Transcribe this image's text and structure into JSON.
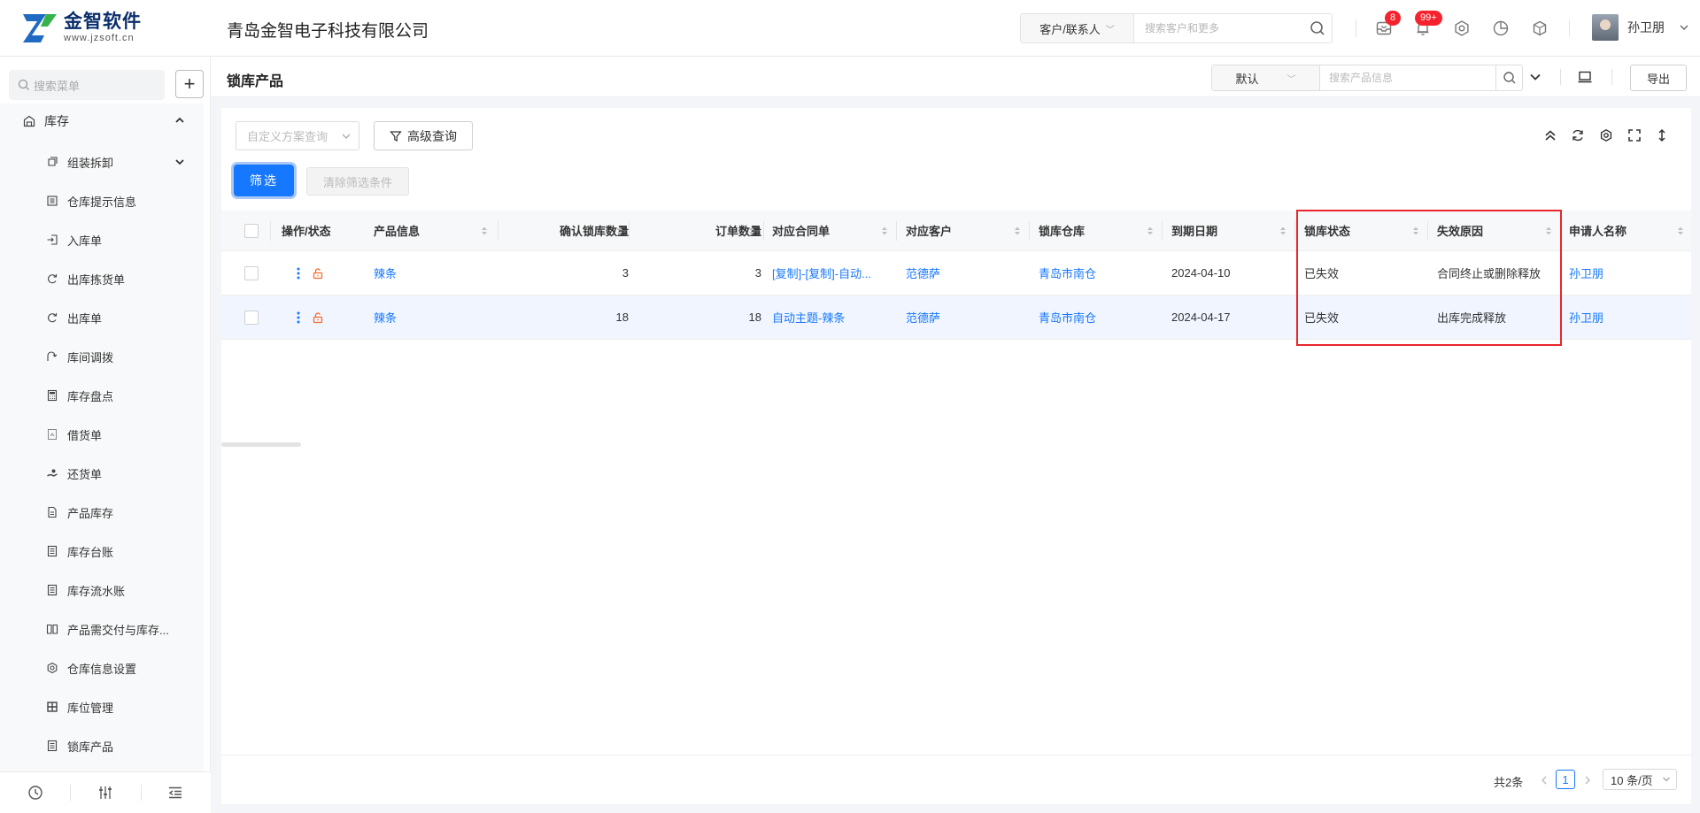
{
  "brand": {
    "name": "金智软件",
    "url": "www.jzsoft.cn",
    "company": "青岛金智电子科技有限公司",
    "color": "#1f6bc1"
  },
  "header": {
    "search_scope": "客户/联系人",
    "search_placeholder": "搜索客户和更多",
    "message_badge": "8",
    "notification_badge": "99+",
    "user_name": "孙卫朋"
  },
  "sidebar": {
    "search_placeholder": "搜索菜单",
    "group_label": "库存",
    "items": [
      {
        "label": "组装拆卸",
        "icon": "assembly-icon",
        "has_children": true
      },
      {
        "label": "仓库提示信息",
        "icon": "list-icon"
      },
      {
        "label": "入库单",
        "icon": "inbound-icon"
      },
      {
        "label": "出库拣货单",
        "icon": "pick-icon"
      },
      {
        "label": "出库单",
        "icon": "outbound-icon"
      },
      {
        "label": "库间调拨",
        "icon": "transfer-icon"
      },
      {
        "label": "库存盘点",
        "icon": "calculator-icon"
      },
      {
        "label": "借货单",
        "icon": "borrow-icon"
      },
      {
        "label": "还货单",
        "icon": "return-icon"
      },
      {
        "label": "产品库存",
        "icon": "document-icon"
      },
      {
        "label": "库存台账",
        "icon": "ledger-icon"
      },
      {
        "label": "库存流水账",
        "icon": "journal-icon"
      },
      {
        "label": "产品需交付与库存...",
        "icon": "book-icon"
      },
      {
        "label": "仓库信息设置",
        "icon": "settings-icon"
      },
      {
        "label": "库位管理",
        "icon": "grid-icon"
      },
      {
        "label": "锁库产品",
        "icon": "lock-list-icon"
      }
    ]
  },
  "page": {
    "title": "锁库产品",
    "search_scope": "默认",
    "search_placeholder": "搜索产品信息",
    "export_label": "导出"
  },
  "toolbar": {
    "scheme_placeholder": "自定义方案查询",
    "advanced_label": "高级查询",
    "filter_label": "筛选",
    "clear_label": "清除筛选条件"
  },
  "table": {
    "columns": [
      "操作/状态",
      "产品信息",
      "确认锁库数量",
      "订单数量",
      "对应合同单",
      "对应客户",
      "锁库仓库",
      "到期日期",
      "锁库状态",
      "失效原因",
      "申请人名称"
    ],
    "rows": [
      {
        "product": "辣条",
        "confirmed_qty": "3",
        "order_qty": "3",
        "contract": "[复制]-[复制]-自动...",
        "customer": "范德萨",
        "warehouse": "青岛市南仓",
        "due_date": "2024-04-10",
        "status": "已失效",
        "reason": "合同终止或删除释放",
        "applicant": "孙卫朋"
      },
      {
        "product": "辣条",
        "confirmed_qty": "18",
        "order_qty": "18",
        "contract": "自动主题-辣条",
        "customer": "范德萨",
        "warehouse": "青岛市南仓",
        "due_date": "2024-04-17",
        "status": "已失效",
        "reason": "出库完成释放",
        "applicant": "孙卫朋"
      }
    ]
  },
  "pagination": {
    "total": "共2条",
    "current": "1",
    "page_size": "10 条/页"
  }
}
